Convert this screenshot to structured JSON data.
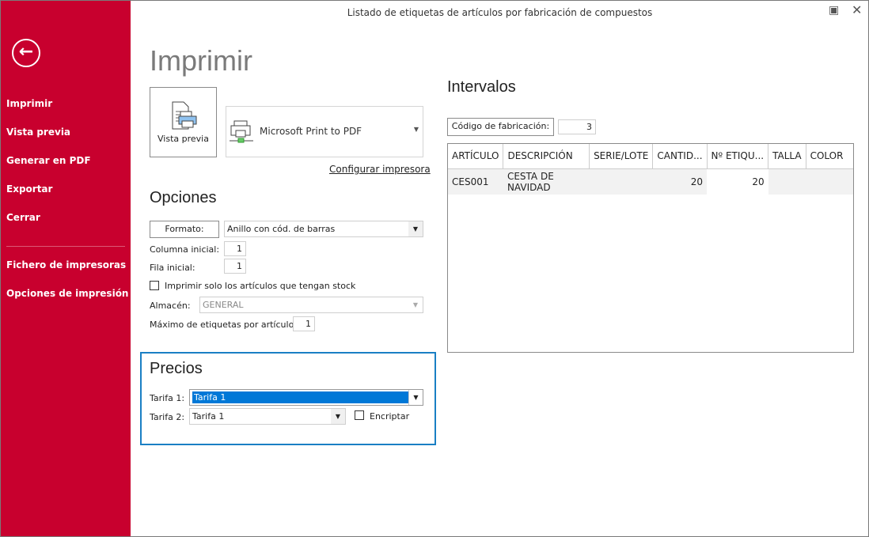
{
  "window": {
    "title": "Listado de etiquetas de artículos por fabricación de compuestos",
    "maximize_icon": "maximize-icon",
    "close_icon": "close-icon"
  },
  "sidebar": {
    "back_icon": "arrow-left-circle-icon",
    "items": [
      {
        "label": "Imprimir"
      },
      {
        "label": "Vista previa"
      },
      {
        "label": "Generar en PDF"
      },
      {
        "label": "Exportar"
      },
      {
        "label": "Cerrar"
      },
      {
        "label": "Fichero de impresoras"
      },
      {
        "label": "Opciones de impresión"
      }
    ],
    "bg_color": "#c8002e"
  },
  "print": {
    "heading": "Imprimir",
    "preview_label": "Vista previa",
    "printer": "Microsoft Print to PDF",
    "configure_link": "Configurar impresora"
  },
  "options": {
    "heading": "Opciones",
    "format_label": "Formato:",
    "format_value": "Anillo con cód. de barras",
    "column_label": "Columna inicial:",
    "column_value": "1",
    "row_label": "Fila inicial:",
    "row_value": "1",
    "stock_only_label": "Imprimir solo los artículos que tengan stock",
    "stock_only_checked": false,
    "warehouse_label": "Almacén:",
    "warehouse_value": "GENERAL",
    "max_label": "Máximo de etiquetas por artículo:",
    "max_value": "1"
  },
  "prices": {
    "heading": "Precios",
    "tarifa1_label": "Tarifa 1:",
    "tarifa1_value": "Tarifa 1",
    "tarifa2_label": "Tarifa 2:",
    "tarifa2_value": "Tarifa 1",
    "encrypt_label": "Encriptar",
    "encrypt_checked": false
  },
  "intervals": {
    "heading": "Intervalos",
    "code_label": "Código de fabricación:",
    "code_value": "3",
    "columns": [
      "ARTÍCULO",
      "DESCRIPCIÓN",
      "SERIE/LOTE",
      "CANTID...",
      "Nº ETIQU...",
      "TALLA",
      "COLOR"
    ],
    "rows": [
      [
        "CES001",
        "CESTA DE NAVIDAD",
        "",
        "20",
        "20",
        "",
        ""
      ]
    ]
  }
}
